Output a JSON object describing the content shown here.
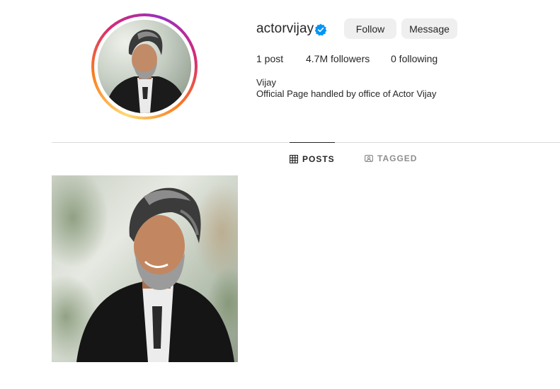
{
  "profile": {
    "username": "actorvijay",
    "verified_icon": "verified-badge-icon",
    "full_name": "Vijay",
    "bio": "Official Page handled by office of Actor Vijay"
  },
  "actions": {
    "follow_label": "Follow",
    "message_label": "Message"
  },
  "stats": {
    "posts": "1 post",
    "followers": "4.7M followers",
    "following": "0 following"
  },
  "tabs": [
    {
      "label": "POSTS",
      "icon": "grid-icon",
      "active": true
    },
    {
      "label": "TAGGED",
      "icon": "tagged-icon",
      "active": false
    }
  ],
  "colors": {
    "button_bg": "#efefef",
    "verified": "#0095f6",
    "text": "#262626",
    "muted": "#8e8e8e",
    "divider": "#dbdbdb"
  }
}
